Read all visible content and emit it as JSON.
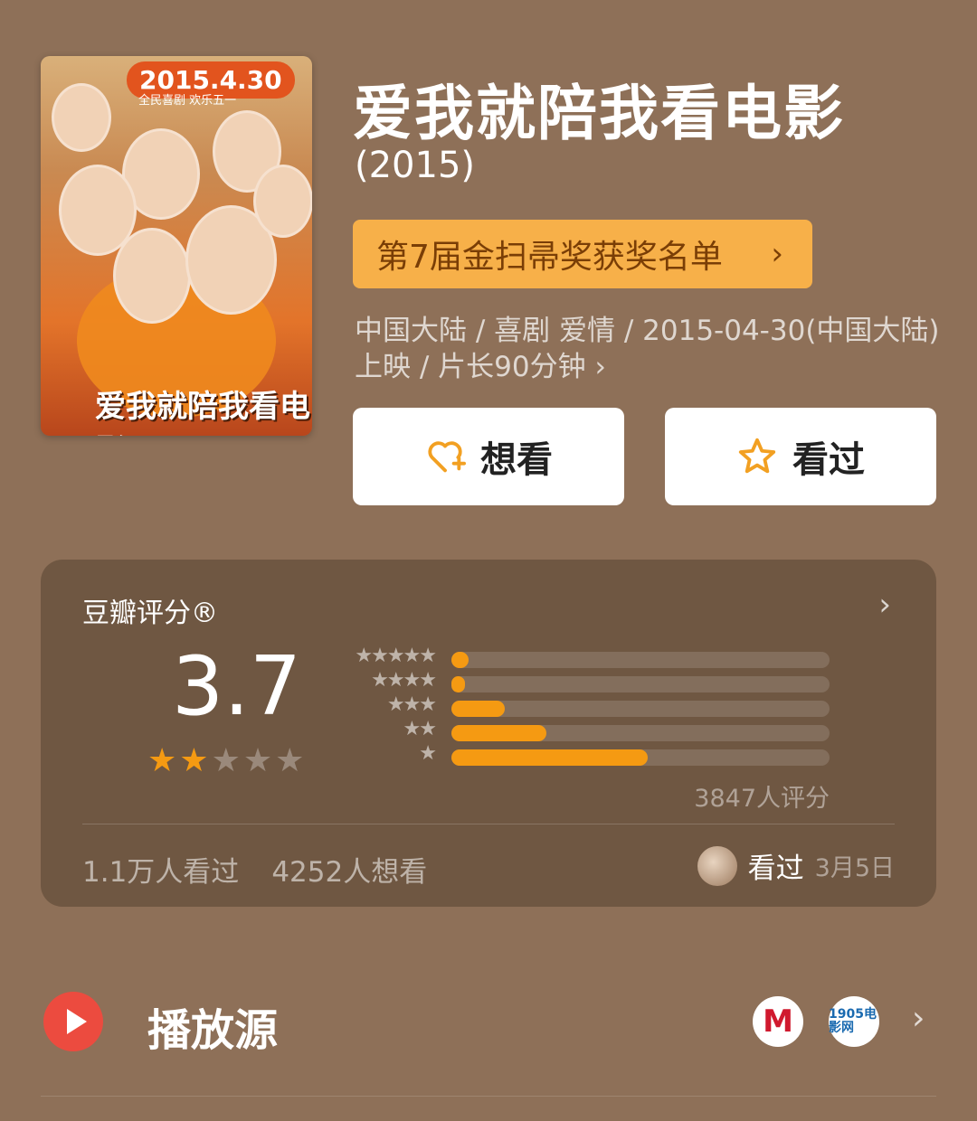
{
  "movie": {
    "title": "爱我就陪我看电影",
    "year": "(2015)",
    "award_label": "第7届金扫帚奖获奖名单",
    "meta": "中国大陆 / 喜剧 爱情 / 2015-04-30(中国大陆)上映 / 片长90分钟 ›",
    "poster": {
      "date": "2015.4.30",
      "subtitle": "全民喜剧 欢乐五一",
      "title_art": "爱我就陪我看电影"
    }
  },
  "actions": {
    "want_label": "想看",
    "watched_label": "看过"
  },
  "rating": {
    "label": "豆瓣评分®",
    "score": "3.7",
    "star_fill": 0.4,
    "distribution": [
      {
        "stars": "★★★★★",
        "fraction": 0.045
      },
      {
        "stars": "★★★★",
        "fraction": 0.035
      },
      {
        "stars": "★★★",
        "fraction": 0.14
      },
      {
        "stars": "★★",
        "fraction": 0.25
      },
      {
        "stars": "★",
        "fraction": 0.52
      }
    ],
    "count": "3847人评分",
    "watched": "1.1万人看过",
    "wants": "4252人想看",
    "user_status": "看过",
    "user_date": "3月5日"
  },
  "play": {
    "label": "播放源",
    "sources": [
      "M",
      "1905电影网"
    ]
  },
  "colors": {
    "background": "#8e7058",
    "accent": "#f59a12",
    "award_bg": "#f7b049",
    "play_red": "#ec4b3f"
  }
}
